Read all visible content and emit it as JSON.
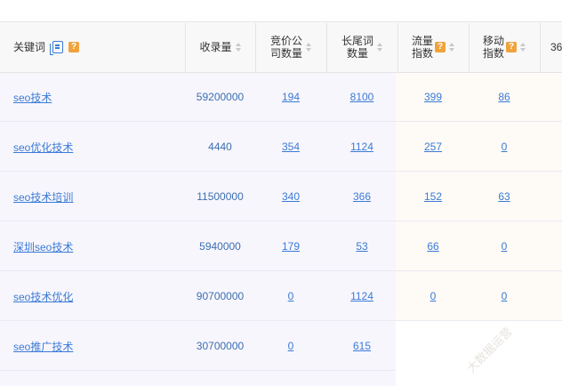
{
  "headers": {
    "keyword": "关键词",
    "keyword_help": "?",
    "volume": "收录量",
    "competitors": "竞价公\n司数量",
    "longtail": "长尾词\n数量",
    "traffic": "流量\n指数",
    "traffic_help": "?",
    "mobile": "移动\n指数",
    "mobile_help": "?",
    "extra": "36"
  },
  "rows": [
    {
      "keyword": "seo技术",
      "volume": "59200000",
      "competitors": "194",
      "longtail": "8100",
      "traffic": "399",
      "mobile": "86"
    },
    {
      "keyword": "seo优化技术",
      "volume": "4440",
      "competitors": "354",
      "longtail": "1124",
      "traffic": "257",
      "mobile": "0"
    },
    {
      "keyword": "seo技术培训",
      "volume": "11500000",
      "competitors": "340",
      "longtail": "366",
      "traffic": "152",
      "mobile": "63"
    },
    {
      "keyword": "深圳seo技术",
      "volume": "5940000",
      "competitors": "179",
      "longtail": "53",
      "traffic": "66",
      "mobile": "0"
    },
    {
      "keyword": "seo技术优化",
      "volume": "90700000",
      "competitors": "0",
      "longtail": "1124",
      "traffic": "0",
      "mobile": "0"
    },
    {
      "keyword": "seo推广技术",
      "volume": "30700000",
      "competitors": "0",
      "longtail": "615",
      "traffic": "",
      "mobile": ""
    }
  ],
  "watermark": "大数据运营",
  "icons": {
    "copy": "copy-icon",
    "sort": "sort-icon",
    "help": "help-icon"
  },
  "colors": {
    "link": "#3a7bd5",
    "help_badge": "#f0a33c",
    "row_bg_left": "#f8f6fd",
    "row_bg_right": "#fefaf6"
  }
}
